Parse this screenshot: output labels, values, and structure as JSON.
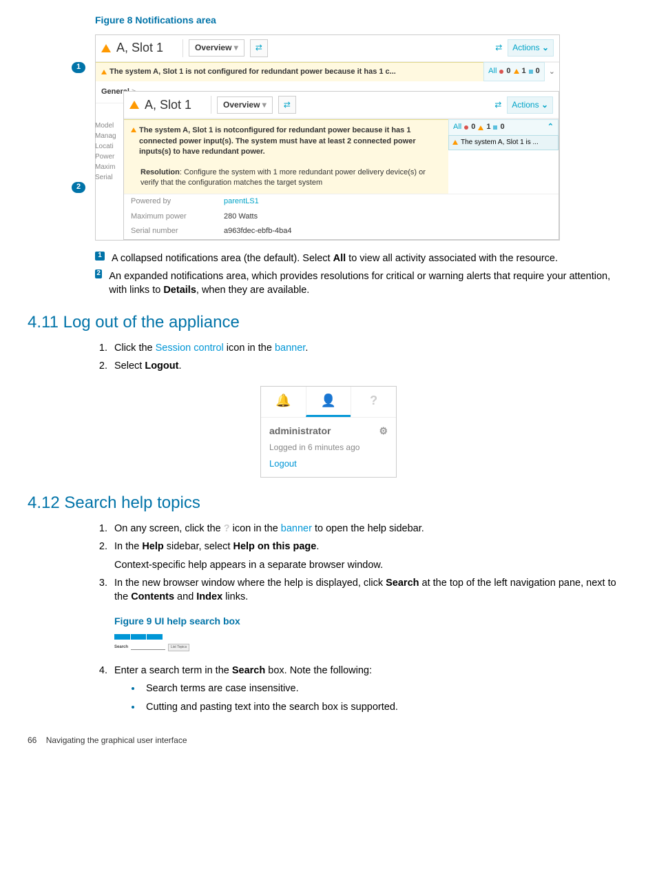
{
  "figure8": {
    "title": "Figure 8 Notifications area",
    "panel1": {
      "slot": "A, Slot 1",
      "overview": "Overview",
      "actions": "Actions",
      "msg": "The system A, Slot 1 is not configured for redundant power because it has 1 c...",
      "all": "All",
      "count_crit": "0",
      "count_warn": "1",
      "count_info": "0",
      "general": "General"
    },
    "sidebar": [
      "Model",
      "Manag",
      "Locati",
      "Power",
      "Maxim",
      "Serial"
    ],
    "panel2": {
      "slot": "A, Slot 1",
      "overview": "Overview",
      "actions": "Actions",
      "msg": "The system A, Slot 1 is notconfigured for redundant power because it has 1 connected power input(s). The system must have at least 2 connected power inputs(s) to have redundant power.",
      "all": "All",
      "count_crit": "0",
      "count_warn": "1",
      "count_info": "0",
      "selected": "The system A, Slot 1 is ...",
      "res_label": "Resolution",
      "res_text": ": Configure the system with 1 more redundant power delivery device(s) or verify that the configuration matches the target system",
      "rows": [
        {
          "k": "Powered by",
          "v": "parentLS1",
          "link": true
        },
        {
          "k": "Maximum power",
          "v": "280 Watts",
          "link": false
        },
        {
          "k": "Serial number",
          "v": "a963fdec-ebfb-4ba4",
          "link": false
        }
      ]
    }
  },
  "legend": [
    {
      "n": "1",
      "pre": "A collapsed notifications area (the default). Select ",
      "bold": "All",
      "post": " to view all activity associated with the resource."
    },
    {
      "n": "2",
      "pre": "An expanded notifications area, which provides resolutions for critical or warning alerts that require your attention, with links to ",
      "bold": "Details",
      "post": ", when they are available."
    }
  ],
  "s411": {
    "title": "4.11 Log out of the appliance",
    "steps": [
      {
        "pre": "Click the ",
        "link1": "Session control",
        "mid": " icon in the ",
        "link2": "banner",
        "post": "."
      },
      {
        "pre": "Select ",
        "bold": "Logout",
        "post": "."
      }
    ],
    "session": {
      "user": "administrator",
      "time": "Logged in 6 minutes ago",
      "logout": "Logout"
    }
  },
  "s412": {
    "title": "4.12 Search help topics",
    "steps": {
      "s1": {
        "pre": "On any screen, click the ",
        "icon": "?",
        "mid": " icon in the ",
        "link": "banner",
        "post": " to open the help sidebar."
      },
      "s2": {
        "pre": "In the ",
        "b1": "Help",
        "mid": " sidebar, select ",
        "b2": "Help on this page",
        "post": ".",
        "sub": "Context-specific help appears in a separate browser window."
      },
      "s3": {
        "pre": "In the new browser window where the help is displayed, click ",
        "b1": "Search",
        "mid": " at the top of the left navigation pane, next to the ",
        "b2": "Contents",
        "mid2": " and ",
        "b3": "Index",
        "post": " links."
      },
      "fig9": "Figure 9 UI help search box",
      "s4": {
        "pre": "Enter a search term in the ",
        "b1": "Search",
        "post": " box. Note the following:",
        "bullets": [
          "Search terms are case insensitive.",
          "Cutting and pasting text into the search box is supported."
        ]
      }
    }
  },
  "footer": {
    "page": "66",
    "title": "Navigating the graphical user interface"
  }
}
